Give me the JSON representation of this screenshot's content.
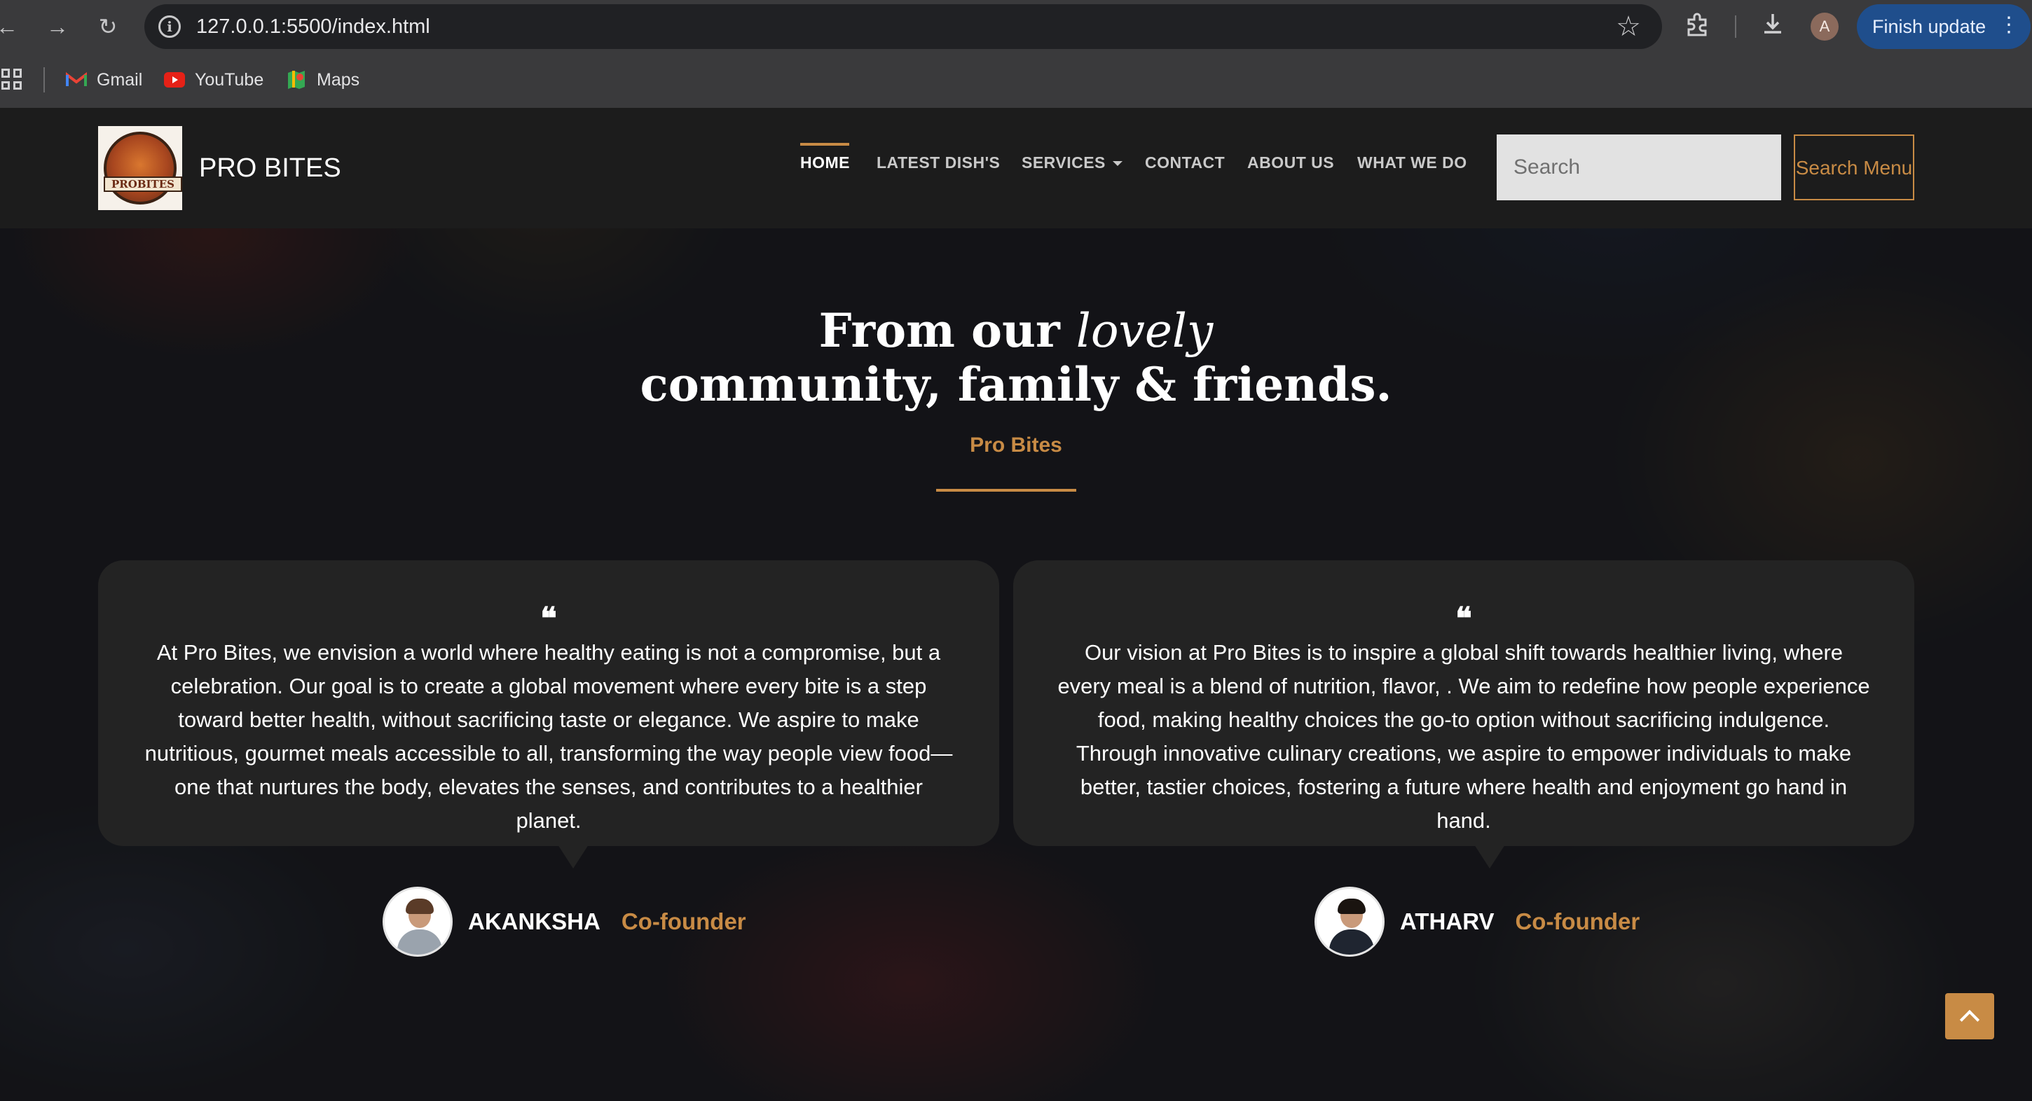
{
  "browser": {
    "url": "127.0.0.1:5500/index.html",
    "profile_initial": "A",
    "finish_update_label": "Finish update",
    "bookmarks": [
      {
        "label": "Gmail",
        "icon": "gmail-icon"
      },
      {
        "label": "YouTube",
        "icon": "youtube-icon"
      },
      {
        "label": "Maps",
        "icon": "maps-icon"
      }
    ]
  },
  "site": {
    "logo_text": "PROBITES",
    "brand": "PRO BITES",
    "nav": [
      {
        "label": "HOME",
        "active": true
      },
      {
        "label": "LATEST DISH'S"
      },
      {
        "label": "SERVICES",
        "dropdown": true
      },
      {
        "label": "CONTACT"
      },
      {
        "label": "ABOUT US"
      },
      {
        "label": "WHAT WE DO"
      }
    ],
    "search_placeholder": "Search",
    "search_button": "Search Menu",
    "accent_color": "#c88b45"
  },
  "hero": {
    "heading_pre": "From our",
    "heading_em": "lovely",
    "heading_line2": "community, family & friends.",
    "subtitle": "Pro Bites"
  },
  "testimonials": [
    {
      "quote_mark": "❝",
      "text": "At Pro Bites, we envision a world where healthy eating is not a compromise, but a celebration. Our goal is to create a global movement where every bite is a step toward better health, without sacrificing taste or elegance. We aspire to make nutritious, gourmet meals accessible to all, transforming the way people view food—one that nurtures the body, elevates the senses, and contributes to a healthier planet.",
      "name": "AKANKSHA",
      "role": "Co-founder"
    },
    {
      "quote_mark": "❝",
      "text": "Our vision at Pro Bites is to inspire a global shift towards healthier living, where every meal is a blend of nutrition, flavor, . We aim to redefine how people experience food, making healthy choices the go-to option without sacrificing indulgence. Through innovative culinary creations, we aspire to empower individuals to make better, tastier choices, fostering a future where health and enjoyment go hand in hand.",
      "name": "ATHARV",
      "role": "Co-founder"
    }
  ]
}
